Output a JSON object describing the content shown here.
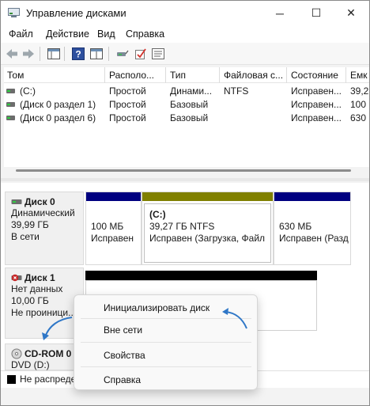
{
  "window": {
    "title": "Управление дисками",
    "controls": {
      "minimize": "─",
      "maximize": "☐",
      "close": "✕"
    }
  },
  "menu": [
    "Файл",
    "Действие",
    "Вид",
    "Справка"
  ],
  "toolbar": {
    "icons": [
      "back-arrow-icon",
      "forward-arrow-icon",
      "console-tree-icon",
      "help-icon",
      "properties-icon",
      "connect-icon",
      "check-icon",
      "list-icon"
    ]
  },
  "volumes": {
    "columns": [
      "Том",
      "Располо...",
      "Тип",
      "Файловая с...",
      "Состояние",
      "Емк"
    ],
    "rows": [
      {
        "name": "(C:)",
        "layout": "Простой",
        "type": "Динами...",
        "fs": "NTFS",
        "status": "Исправен...",
        "capacity": "39,2"
      },
      {
        "name": "(Диск 0 раздел 1)",
        "layout": "Простой",
        "type": "Базовый",
        "fs": "",
        "status": "Исправен...",
        "capacity": "100"
      },
      {
        "name": "(Диск 0 раздел 6)",
        "layout": "Простой",
        "type": "Базовый",
        "fs": "",
        "status": "Исправен...",
        "capacity": "630"
      }
    ]
  },
  "disks": {
    "disk0": {
      "name": "Диск 0",
      "kind": "Динамический",
      "size": "39,99 ГБ",
      "state": "В сети",
      "partitions": [
        {
          "title": "",
          "line1": "100 МБ",
          "line2": "Исправен",
          "color": "#000080"
        },
        {
          "title": "(C:)",
          "line1": "39,27 ГБ NTFS",
          "line2": "Исправен (Загрузка, Файл п",
          "color": "#808000"
        },
        {
          "title": "",
          "line1": "630 МБ",
          "line2": "Исправен (Разд",
          "color": "#000080"
        }
      ]
    },
    "disk1": {
      "name": "Диск 1",
      "kind": "Нет данных",
      "size": "10,00 ГБ",
      "state": "Не проиници..."
    },
    "cdrom": {
      "name": "CD-ROM 0",
      "kind": "DVD (D:)"
    }
  },
  "legend": {
    "unallocated": "Не распреде..."
  },
  "context_menu": {
    "items": [
      "Инициализировать диск",
      "Вне сети",
      "Свойства",
      "Справка"
    ]
  },
  "colors": {
    "primary_partition": "#000080",
    "dynamic_simple": "#808000",
    "annotation_arrow": "#2f77c7"
  }
}
